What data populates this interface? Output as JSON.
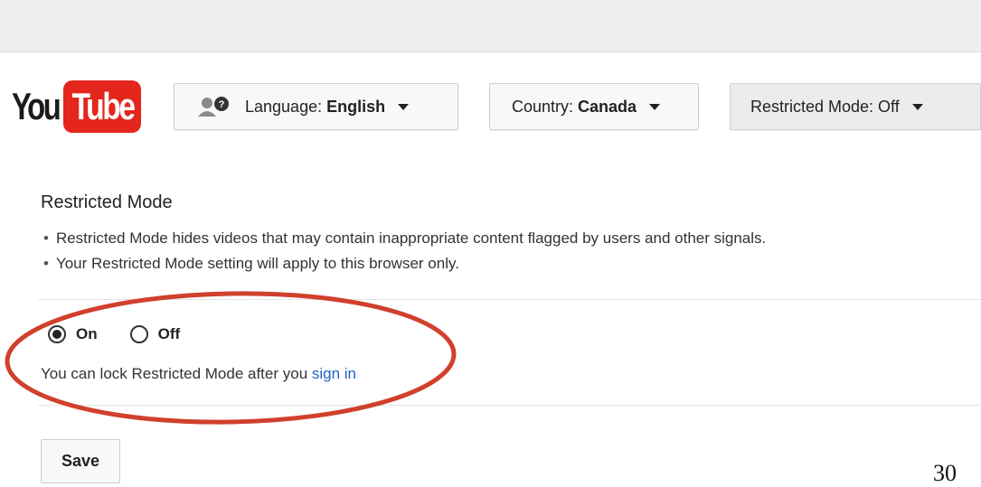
{
  "logo": {
    "you": "You",
    "tube": "Tube"
  },
  "dropdowns": {
    "language": {
      "label": "Language:",
      "value": "English"
    },
    "country": {
      "label": "Country:",
      "value": "Canada"
    },
    "restricted": {
      "label": "Restricted Mode: Off"
    }
  },
  "restricted_mode": {
    "title": "Restricted Mode",
    "bullets": [
      "Restricted Mode hides videos that may contain inappropriate content flagged by users and other signals.",
      "Your Restricted Mode setting will apply to this browser only."
    ],
    "options": [
      {
        "label": "On",
        "selected": true
      },
      {
        "label": "Off",
        "selected": false
      }
    ],
    "lock_text": "You can lock Restricted Mode after you ",
    "sign_in_link": "sign in",
    "save_label": "Save"
  },
  "annotation": {
    "color": "#d0402c"
  },
  "colors": {
    "brand": "#e4261d",
    "link": "#1f63c2"
  },
  "page_number": "30"
}
